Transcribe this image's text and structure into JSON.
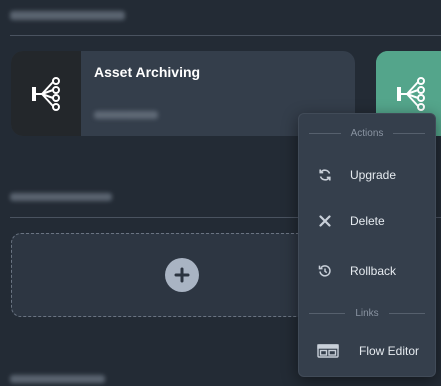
{
  "cards": [
    {
      "title": "Asset Archiving",
      "icon": "flow-icon"
    },
    {
      "title": "",
      "icon": "flow-icon"
    }
  ],
  "add_flow": {
    "icon": "plus-icon"
  },
  "context_menu": {
    "actions_heading": "Actions",
    "items": [
      {
        "label": "Upgrade",
        "icon": "refresh-icon"
      },
      {
        "label": "Delete",
        "icon": "close-icon"
      },
      {
        "label": "Rollback",
        "icon": "rollback-icon"
      }
    ],
    "links_heading": "Links",
    "links": [
      {
        "label": "Flow Editor",
        "icon": "editor-window-icon"
      }
    ]
  },
  "colors": {
    "background": "#232b35",
    "card": "#343e4b",
    "card_icon_dark": "#23272b",
    "card_teal": "#54a58b",
    "menu": "#353f4c"
  }
}
